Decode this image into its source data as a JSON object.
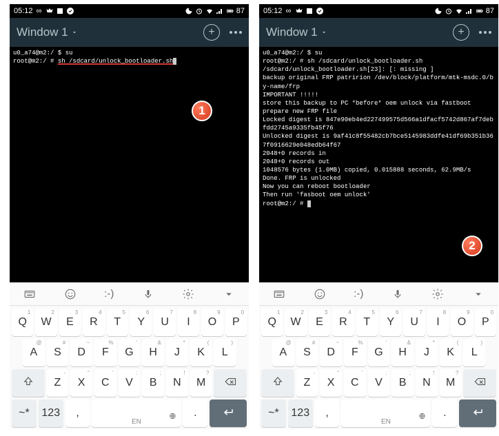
{
  "statusbar": {
    "time": "05:12",
    "battery": "87"
  },
  "appbar": {
    "window_label": "Window 1"
  },
  "terminal": {
    "left": {
      "line1_prompt": "u0_a74@m2:/ $ ",
      "line1_cmd": "su",
      "line2_prompt": "root@m2:/ # ",
      "line2_cmd": "sh /sdcard/unlock_bootloader.sh"
    },
    "right": {
      "lines": [
        "u0_a74@m2:/ $ su",
        "root@m2:/ # sh /sdcard/unlock_bootloader.sh",
        "/sdcard/unlock_bootloader.sh[23]: [: missing ]",
        "backup original FRP patririon /dev/block/platform/mtk-msdc.0/by-name/frp",
        "IMPORTANT !!!!!",
        "store this backup to PC *before* oem unlock via fastboot",
        "prepare new FRP file",
        "Locked digest is 847e90eb4ed227499575d566a1dfacf5742d867af7debfdd2745a9335fb45f76",
        "Unlocked digest is 9af41c8f55482cb7bce5145983ddfe41df69b351b367f0916629e048edb64f67",
        "2048+0 records in",
        "2048+0 records out",
        "1048576 bytes (1.0MB) copied, 0.015888 seconds, 62.9MB/s",
        "Done. FRP is unlocked",
        "Now you can reboot bootloader",
        "Then run 'fasboot oem unlock'",
        "root@m2:/ # "
      ]
    }
  },
  "badges": {
    "one": "1",
    "two": "2"
  },
  "keyboard": {
    "toolbar_emoticon": ":-)",
    "row1": [
      {
        "m": "Q",
        "a": "1"
      },
      {
        "m": "W",
        "a": "2"
      },
      {
        "m": "E",
        "a": "3"
      },
      {
        "m": "R",
        "a": "4"
      },
      {
        "m": "T",
        "a": "5"
      },
      {
        "m": "Y",
        "a": "6"
      },
      {
        "m": "U",
        "a": "7"
      },
      {
        "m": "I",
        "a": "8"
      },
      {
        "m": "O",
        "a": "9"
      },
      {
        "m": "P",
        "a": "0"
      }
    ],
    "row2": [
      {
        "m": "A",
        "a": "@"
      },
      {
        "m": "S",
        "a": "#"
      },
      {
        "m": "D",
        "a": "~"
      },
      {
        "m": "F",
        "a": "%"
      },
      {
        "m": "G",
        "a": "'"
      },
      {
        "m": "H",
        "a": "&"
      },
      {
        "m": "J",
        "a": "*"
      },
      {
        "m": "K",
        "a": "("
      },
      {
        "m": "L",
        "a": ")"
      }
    ],
    "row3": [
      {
        "m": "Z",
        "a": "-"
      },
      {
        "m": "X",
        "a": "\""
      },
      {
        "m": "C",
        "a": "'"
      },
      {
        "m": "V",
        "a": ":"
      },
      {
        "m": "B",
        "a": ";"
      },
      {
        "m": "N",
        "a": "!"
      },
      {
        "m": "M",
        "a": "?"
      }
    ],
    "row4": {
      "swipe": "~*",
      "num": "123",
      "comma": ",",
      "lang": "EN",
      "period": "."
    }
  }
}
